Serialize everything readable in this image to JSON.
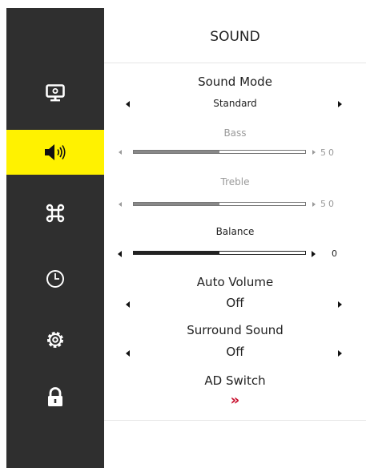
{
  "menu": {
    "title": "SOUND",
    "sidebar": [
      {
        "icon": "monitor-icon",
        "active": false
      },
      {
        "icon": "speaker-icon",
        "active": true
      },
      {
        "icon": "command-icon",
        "active": false
      },
      {
        "icon": "clock-icon",
        "active": false
      },
      {
        "icon": "gear-icon",
        "active": false
      },
      {
        "icon": "lock-icon",
        "active": false
      }
    ],
    "sound_mode": {
      "label": "Sound Mode",
      "value": "Standard"
    },
    "bass": {
      "label": "Bass",
      "value": "50",
      "level": 0.5
    },
    "treble": {
      "label": "Treble",
      "value": "50",
      "level": 0.5
    },
    "balance": {
      "label": "Balance",
      "value": "0",
      "level": 0.5
    },
    "auto_volume": {
      "label": "Auto Volume",
      "value": "Off"
    },
    "surround_sound": {
      "label": "Surround Sound",
      "value": "Off"
    },
    "ad_switch": {
      "label": "AD Switch",
      "value": "»"
    }
  },
  "colors": {
    "sidebar": "#2f2f2f",
    "highlight": "#fff200",
    "accent": "#c8102e"
  }
}
